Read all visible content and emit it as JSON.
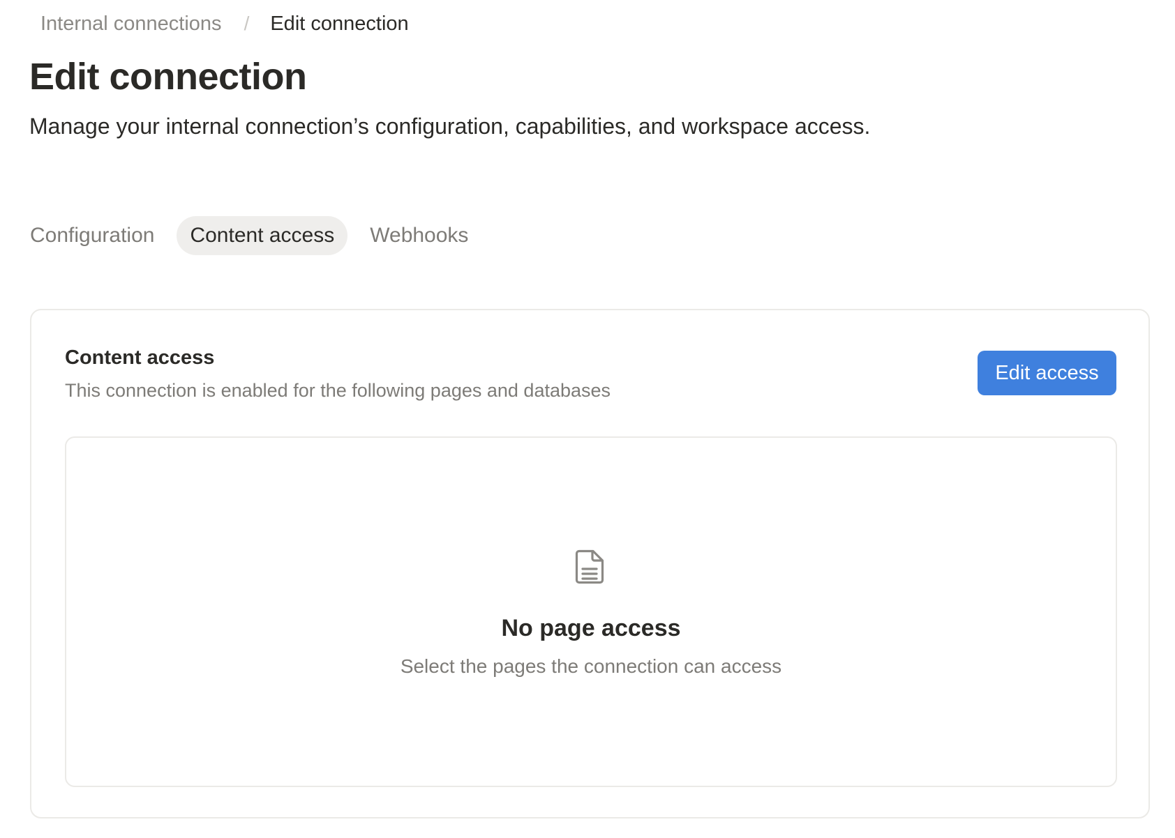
{
  "breadcrumb": {
    "parent": "Internal connections",
    "separator": "/",
    "current": "Edit connection"
  },
  "header": {
    "title": "Edit connection",
    "subtitle": "Manage your internal connection’s configuration, capabilities, and workspace access."
  },
  "tabs": [
    {
      "label": "Configuration",
      "active": false
    },
    {
      "label": "Content access",
      "active": true
    },
    {
      "label": "Webhooks",
      "active": false
    }
  ],
  "content_access": {
    "title": "Content access",
    "description": "This connection is enabled for the following pages and databases",
    "edit_button_label": "Edit access",
    "empty_state": {
      "icon": "document-icon",
      "title": "No page access",
      "description": "Select the pages the connection can access"
    }
  },
  "colors": {
    "primary_button": "#3f80de",
    "active_tab_bg": "#efeeec",
    "border": "#ebeae7",
    "text": "#2b2a27",
    "muted_text": "#7d7b77"
  }
}
